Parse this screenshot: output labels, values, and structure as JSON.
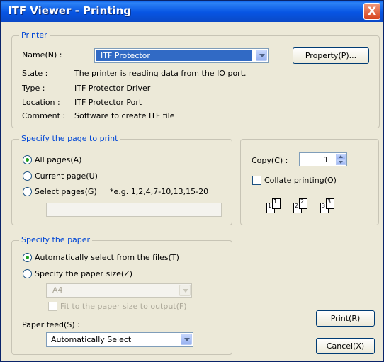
{
  "window": {
    "title": "ITF Viewer - Printing",
    "close_symbol": "X"
  },
  "printer": {
    "group_label": "Printer",
    "name_label": "Name(N) :",
    "name_value": "ITF Protector",
    "property_button": "Property(P)...",
    "state_label": "State :",
    "state_value": "The printer is reading data from the IO port.",
    "type_label": "Type :",
    "type_value": "ITF Protector Driver",
    "location_label": "Location :",
    "location_value": "ITF Protector Port",
    "comment_label": "Comment :",
    "comment_value": "Software to create ITF file"
  },
  "page_range": {
    "group_label": "Specify the page to print",
    "all_pages": "All pages(A)",
    "current_page": "Current page(U)",
    "select_pages": "Select  pages(G)",
    "example": "*e.g. 1,2,4,7-10,13,15-20",
    "selected_option": "All pages(A)",
    "pages_input_value": ""
  },
  "copies": {
    "copy_label": "Copy(C) :",
    "copy_value": "1",
    "collate_label": "Collate printing(O)",
    "collate_checked": false,
    "collate_icon": [
      "1",
      "1",
      "2",
      "2",
      "3",
      "3"
    ]
  },
  "paper": {
    "group_label": "Specify the paper",
    "auto_select": "Automatically select from the files(T)",
    "specify_size": "Specify the paper size(Z)",
    "selected_option": "Automatically select from the files(T)",
    "size_value": "A4",
    "fit_label": "Fit to the paper size to output(F)",
    "fit_checked": false,
    "feed_label": "Paper feed(S) :",
    "feed_value": "Automatically Select"
  },
  "actions": {
    "print_button": "Print(R)",
    "cancel_button": "Cancel(X)"
  },
  "colors": {
    "title_bar": "#0a5ee9",
    "group_label": "#0046d5",
    "dialog_bg": "#ece9d8",
    "selection": "#316ac5"
  }
}
